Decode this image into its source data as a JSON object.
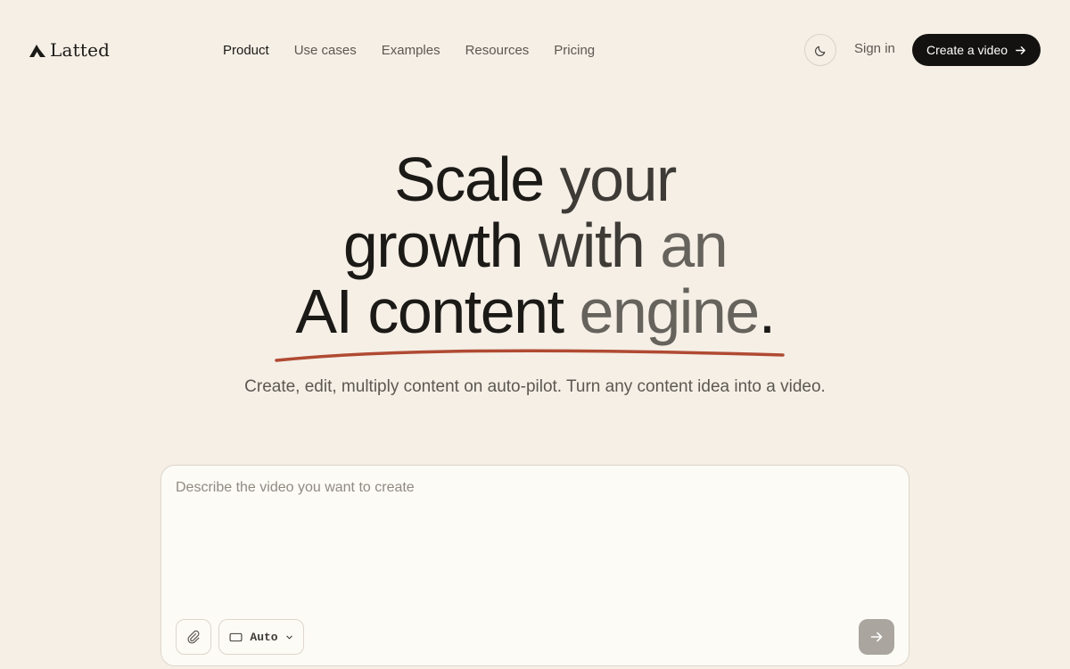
{
  "brand": {
    "name": "Latted",
    "logo_icon": "latted-logo-icon"
  },
  "nav": {
    "items": [
      {
        "label": "Product",
        "active": true
      },
      {
        "label": "Use cases",
        "active": false
      },
      {
        "label": "Examples",
        "active": false
      },
      {
        "label": "Resources",
        "active": false
      },
      {
        "label": "Pricing",
        "active": false
      }
    ]
  },
  "header": {
    "theme_toggle_icon": "moon-icon",
    "sign_in_label": "Sign in",
    "cta_label": "Create a video",
    "cta_icon": "arrow-right-icon"
  },
  "hero": {
    "line1": {
      "a": "Scale",
      "b": " your"
    },
    "line2": {
      "a": "growth",
      "b": " with",
      "c": " an"
    },
    "line3": {
      "a": "AI content",
      "b": " engine",
      "c": "."
    },
    "subtitle": "Create, edit, multiply content on auto-pilot. Turn any content idea into a video."
  },
  "prompt": {
    "placeholder": "Describe the video you want to create",
    "value": "",
    "attach_icon": "paperclip-icon",
    "format_icon": "aspect-ratio-icon",
    "format_value": "Auto",
    "send_icon": "arrow-right-icon"
  },
  "colors": {
    "background": "#f5efe6",
    "cta_background": "#141210",
    "underline": "#b04a32",
    "send_button_disabled": "#aaa59e"
  }
}
